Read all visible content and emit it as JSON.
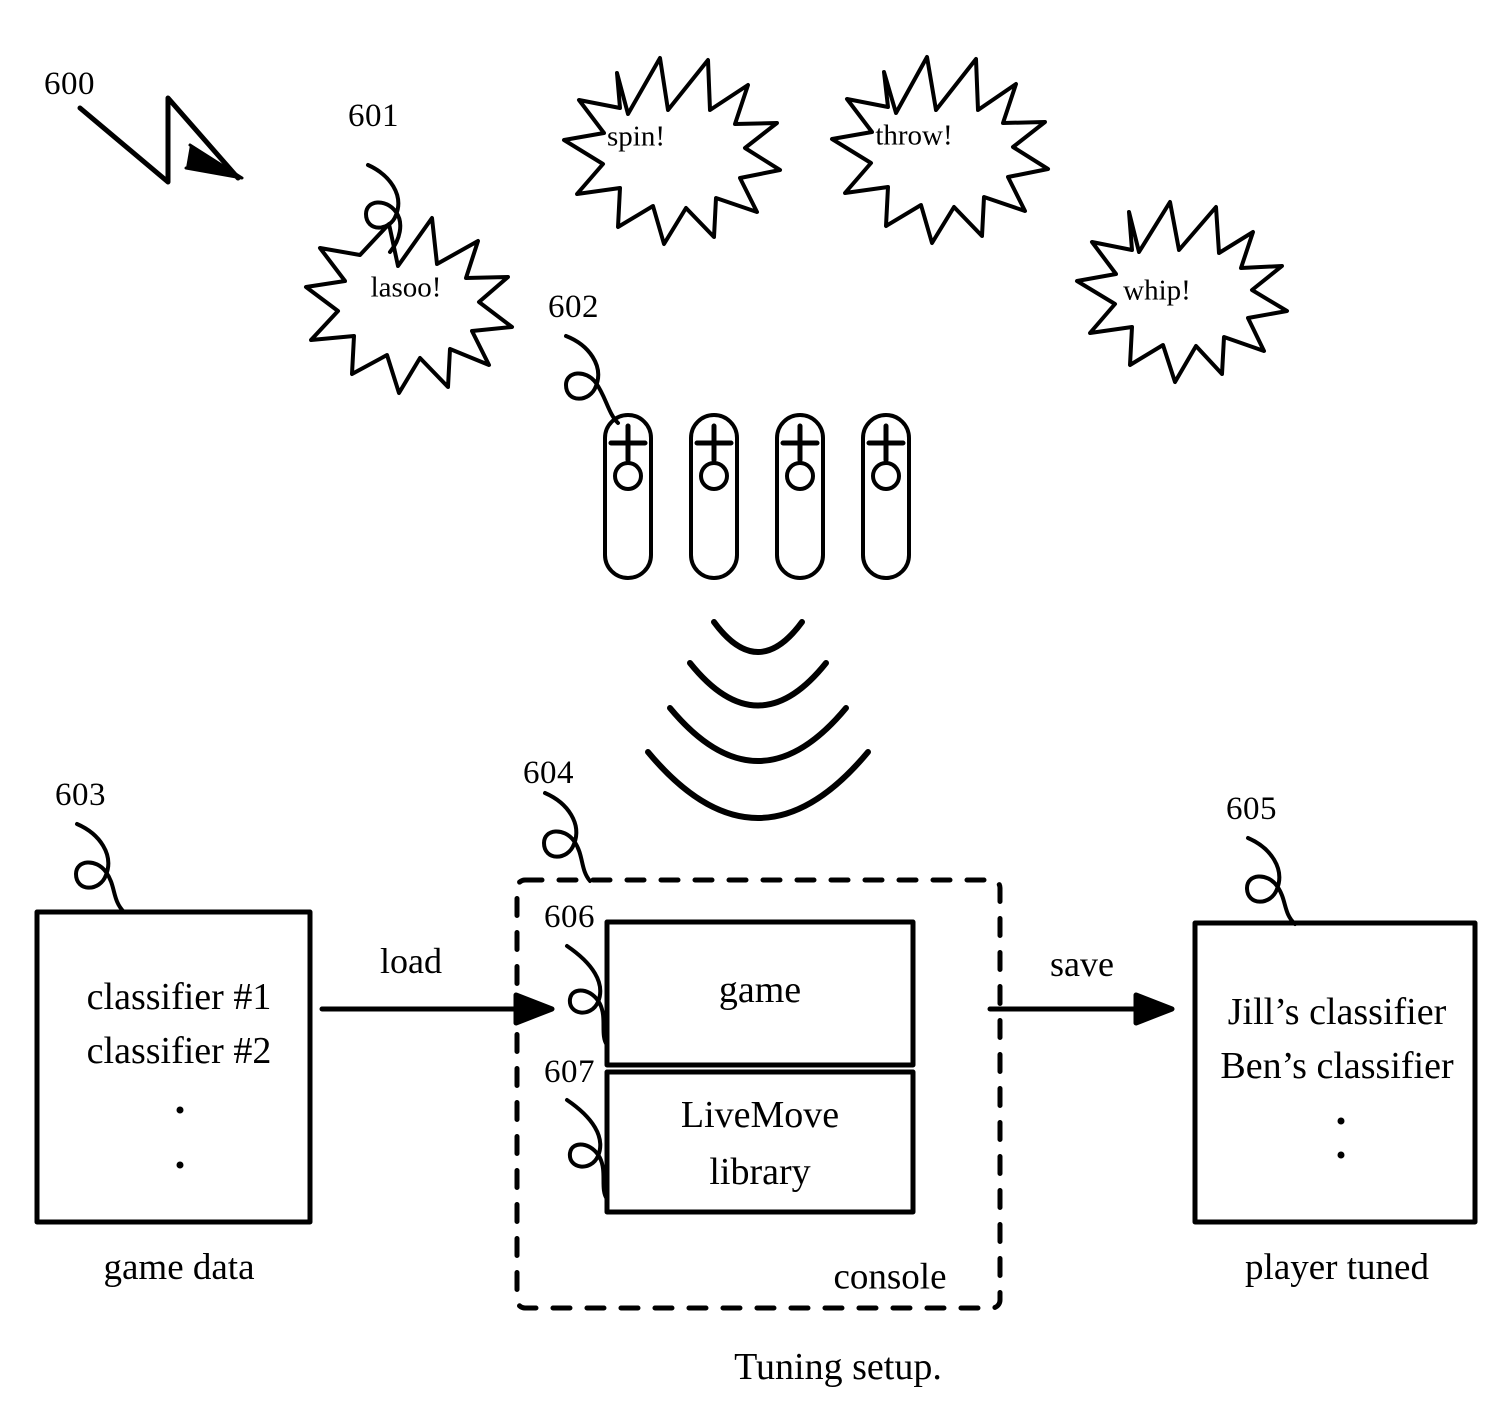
{
  "figure": {
    "caption": "Tuning setup.",
    "reference_numerals": {
      "figure": "600",
      "gesture_burst": "601",
      "controllers": "602",
      "game_data_box": "603",
      "console_box": "604",
      "player_tuned_box": "605",
      "game_module": "606",
      "livemove_module": "607"
    }
  },
  "gesture_bursts": [
    {
      "label": "lasoo!",
      "ref": "601"
    },
    {
      "label": "spin!",
      "ref": ""
    },
    {
      "label": "throw!",
      "ref": ""
    },
    {
      "label": "whip!",
      "ref": ""
    }
  ],
  "controllers": {
    "ref": "602",
    "count": 4,
    "buttons": {
      "dpad": "+",
      "action": "○"
    }
  },
  "wireless_signal": {
    "arc_count": 4
  },
  "game_data": {
    "ref": "603",
    "caption": "game data",
    "lines": [
      "classifier #1",
      "classifier #2"
    ],
    "ellipsis_dots": 2
  },
  "console": {
    "ref": "604",
    "caption": "console",
    "modules": [
      {
        "ref": "606",
        "lines": [
          "game"
        ]
      },
      {
        "ref": "607",
        "lines": [
          "LiveMove",
          "library"
        ]
      }
    ]
  },
  "player_tuned": {
    "ref": "605",
    "caption": "player tuned",
    "lines": [
      "Jill’s classifier",
      "Ben’s classifier"
    ],
    "ellipsis_dots": 2
  },
  "arrows": [
    {
      "label": "load",
      "from": "game-data",
      "to": "console"
    },
    {
      "label": "save",
      "from": "console",
      "to": "player-tuned"
    }
  ],
  "colors": {
    "ink": "#000000",
    "paper": "#ffffff"
  }
}
